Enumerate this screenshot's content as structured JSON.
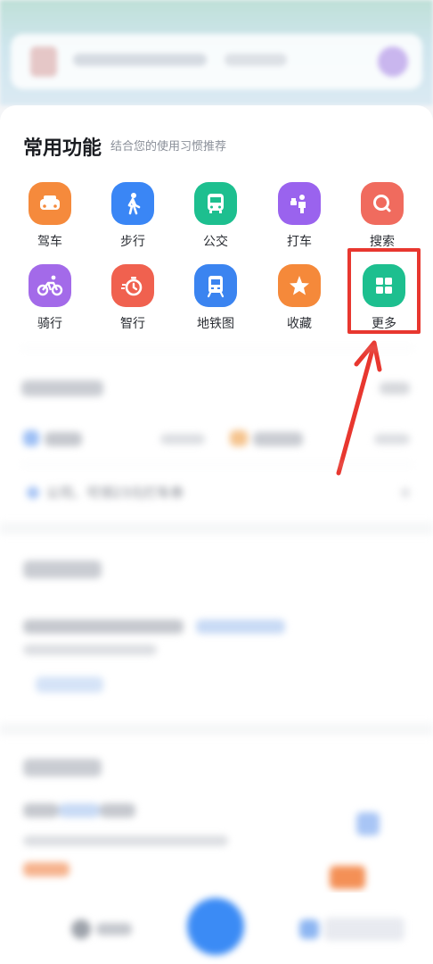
{
  "header": {
    "title": "常用功能",
    "subtitle": "结合您的使用习惯推荐"
  },
  "functions": [
    {
      "label": "驾车",
      "icon": "car-icon",
      "color": "#f58a3c"
    },
    {
      "label": "步行",
      "icon": "walking-person-icon",
      "color": "#3a86f5"
    },
    {
      "label": "公交",
      "icon": "bus-icon",
      "color": "#1dbf8f"
    },
    {
      "label": "打车",
      "icon": "taxi-person-icon",
      "color": "#9a63ee"
    },
    {
      "label": "搜索",
      "icon": "search-icon",
      "color": "#f06b5e"
    },
    {
      "label": "骑行",
      "icon": "bicycle-icon",
      "color": "#a36ae9"
    },
    {
      "label": "智行",
      "icon": "timer-icon",
      "color": "#f0614f"
    },
    {
      "label": "地铁图",
      "icon": "subway-icon",
      "color": "#3b84f0"
    },
    {
      "label": "收藏",
      "icon": "star-icon",
      "color": "#f5893a"
    },
    {
      "label": "更多",
      "icon": "grid-icon",
      "color": "#1dbf8f"
    }
  ],
  "blurred": {
    "promo": "公司、可领23元打车券"
  },
  "colors": {
    "highlight": "#e8372f",
    "arrow": "#e8372f"
  }
}
